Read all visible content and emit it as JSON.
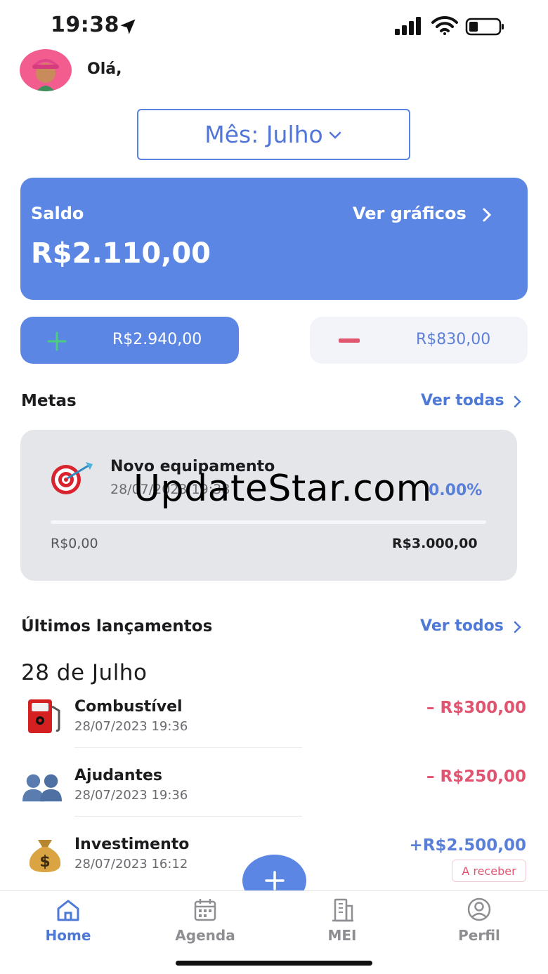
{
  "status_bar": {
    "time": "19:38"
  },
  "header": {
    "greeting": "Olá,"
  },
  "month_selector": {
    "label": "Mês: Julho"
  },
  "balance": {
    "label": "Saldo",
    "value": "R$2.110,00",
    "charts_link": "Ver gráficos"
  },
  "income": {
    "value": "R$2.940,00"
  },
  "expense": {
    "value": "R$830,00"
  },
  "goals": {
    "title": "Metas",
    "see_all": "Ver todas",
    "items": [
      {
        "name": "Novo equipamento",
        "date": "28/07/2023 19:38",
        "percent": "0.00%",
        "progress": 0.0,
        "current": "R$0,00",
        "target": "R$3.000,00",
        "icon": "target-icon"
      }
    ]
  },
  "watermark": "UpdateStar.com",
  "transactions": {
    "title": "Últimos lançamentos",
    "see_all": "Ver todos",
    "date_heading": "28 de Julho",
    "items": [
      {
        "name": "Combustível",
        "date": "28/07/2023 19:36",
        "amount": "– R$300,00",
        "type": "expense",
        "icon": "fuel-pump-icon"
      },
      {
        "name": "Ajudantes",
        "date": "28/07/2023 19:36",
        "amount": "– R$250,00",
        "type": "expense",
        "icon": "people-icon"
      },
      {
        "name": "Investimento",
        "date": "28/07/2023 16:12",
        "amount": "+R$2.500,00",
        "type": "income",
        "icon": "money-bag-icon",
        "badge": "A receber"
      }
    ]
  },
  "tabs": [
    {
      "label": "Home",
      "icon": "home-icon",
      "active": true
    },
    {
      "label": "Agenda",
      "icon": "calendar-icon",
      "active": false
    },
    {
      "label": "MEI",
      "icon": "building-icon",
      "active": false
    },
    {
      "label": "Perfil",
      "icon": "profile-icon",
      "active": false
    }
  ],
  "colors": {
    "accent": "#5b86e3",
    "expense": "#e05470",
    "link": "#4f79d6",
    "card_gray": "#e4e6ea"
  }
}
